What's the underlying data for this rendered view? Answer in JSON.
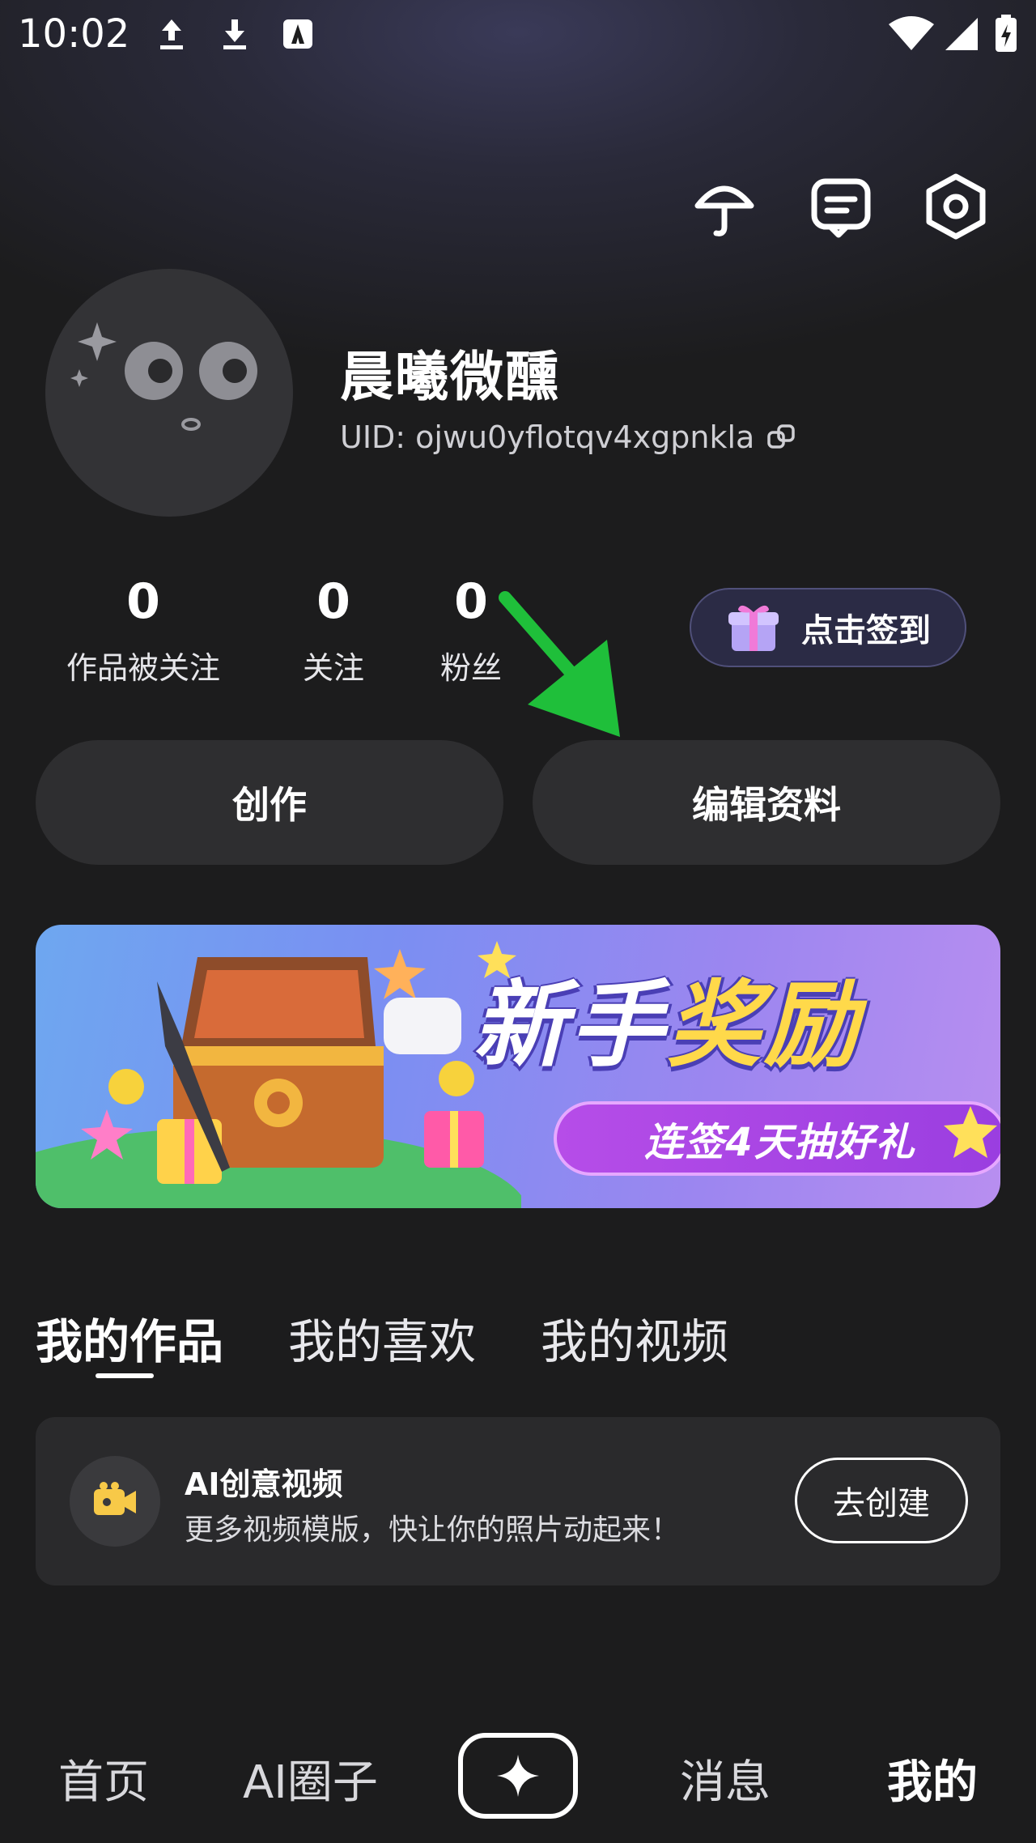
{
  "status_bar": {
    "time": "10:02"
  },
  "profile": {
    "username": "晨曦微醺",
    "uid_label": "UID: ojwu0yflotqv4xgpnkla"
  },
  "stats": [
    {
      "value": "0",
      "label": "作品被关注"
    },
    {
      "value": "0",
      "label": "关注"
    },
    {
      "value": "0",
      "label": "粉丝"
    }
  ],
  "checkin_label": "点击签到",
  "actions": {
    "create": "创作",
    "edit_profile": "编辑资料"
  },
  "banner": {
    "title_part1": "新手",
    "title_part2": "奖励",
    "subtitle": "连签4天抽好礼"
  },
  "tabs": [
    "我的作品",
    "我的喜欢",
    "我的视频"
  ],
  "ai_card": {
    "title": "AI创意视频",
    "description": "更多视频模版，快让你的照片动起来！",
    "button": "去创建"
  },
  "bottom_nav": [
    "首页",
    "AI圈子",
    "消息",
    "我的"
  ],
  "colors": {
    "background": "#1c1c1d",
    "accent_yellow": "#ffd94a",
    "banner_purple": "#9a3ee0",
    "arrow_green": "#1fbf3a"
  }
}
